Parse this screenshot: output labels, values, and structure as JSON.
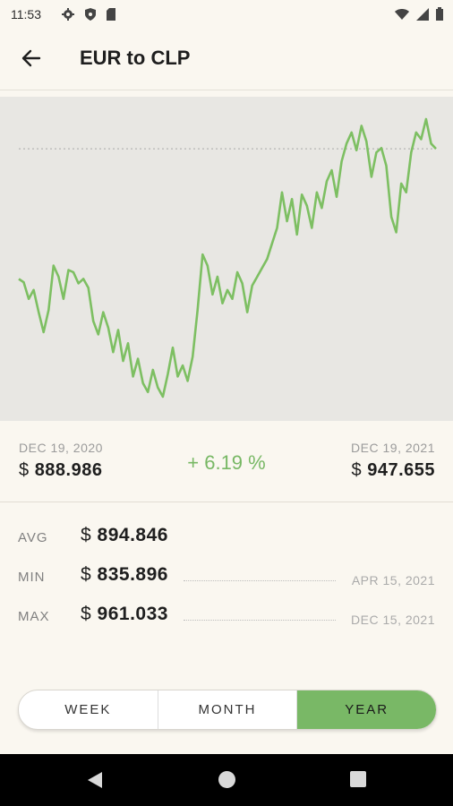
{
  "status": {
    "time": "11:53",
    "left_icons": [
      "gear-icon",
      "shield-icon",
      "sd-card-icon"
    ],
    "right_icons": [
      "wifi-icon",
      "signal-icon",
      "battery-icon"
    ]
  },
  "header": {
    "title": "EUR to CLP",
    "back_icon": "arrow-left-icon"
  },
  "range": {
    "start_date": "DEC 19, 2020",
    "start_currency": "$",
    "start_value": "888.986",
    "change": "+ 6.19 %",
    "end_date": "DEC 19, 2021",
    "end_currency": "$",
    "end_value": "947.655"
  },
  "stats": {
    "avg": {
      "name": "AVG",
      "currency": "$",
      "value": "894.846"
    },
    "min": {
      "name": "MIN",
      "currency": "$",
      "value": "835.896",
      "date": "APR 15, 2021"
    },
    "max": {
      "name": "MAX",
      "currency": "$",
      "value": "961.033",
      "date": "DEC 15, 2021"
    }
  },
  "periods": {
    "week": "WEEK",
    "month": "MONTH",
    "year": "YEAR",
    "selected": "YEAR"
  },
  "colors": {
    "accent": "#79b866",
    "line": "#7dbf62",
    "chart_bg": "#e8e7e3",
    "page_bg": "#faf7f0"
  },
  "chart_data": {
    "type": "line",
    "reference_line": "start value",
    "x_range": [
      "DEC 19, 2020",
      "DEC 19, 2021"
    ],
    "ylim": [
      835.896,
      961.033
    ],
    "series": [
      {
        "values": [
          888.986,
          887.5,
          880.0,
          884.0,
          874.0,
          865.0,
          875.0,
          895.0,
          890.0,
          880.0,
          893.0,
          892.0,
          887.0,
          889.0,
          885.0,
          870.0,
          864.0,
          874.0,
          867.0,
          856.0,
          866.0,
          852.0,
          860.0,
          845.0,
          853.0,
          842.0,
          838.0,
          848.0,
          840.0,
          835.896,
          846.0,
          858.0,
          845.0,
          850.0,
          843.0,
          854.0,
          875.0,
          900.0,
          895.0,
          882.0,
          890.0,
          878.0,
          884.0,
          880.0,
          892.0,
          887.0,
          874.0,
          886.0,
          890.0,
          894.0,
          898.0,
          905.0,
          912.0,
          928.0,
          915.0,
          925.0,
          909.0,
          927.0,
          922.0,
          912.0,
          928.0,
          921.0,
          933.0,
          938.0,
          926.0,
          942.0,
          950.0,
          955.0,
          947.0,
          958.0,
          951.0,
          935.0,
          946.0,
          948.0,
          940.0,
          917.0,
          910.0,
          932.0,
          928.0,
          946.0,
          955.0,
          952.0,
          961.033,
          950.0,
          947.655
        ]
      }
    ]
  }
}
